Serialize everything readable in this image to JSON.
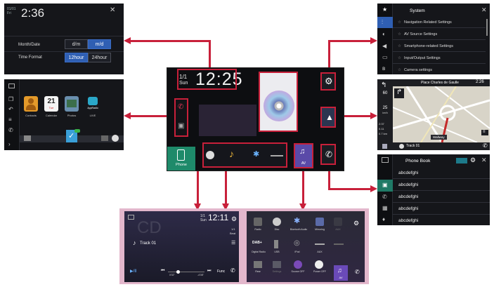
{
  "colors": {
    "accent": "#2f5fb3",
    "arrow": "#c8203a",
    "pink_bg": "#e3b7cc",
    "dark": "#1b1c20"
  },
  "clock_panel": {
    "time": "2:36",
    "date_mini_1": "01/01",
    "date_mini_2": "Fri",
    "rows": [
      {
        "label": "Month/Date",
        "options": [
          "d/m",
          "m/d"
        ],
        "selected": 1
      },
      {
        "label": "Time Format",
        "options": [
          "12hour",
          "24hour"
        ],
        "selected": 0
      }
    ]
  },
  "apps_panel": {
    "apps": [
      {
        "label": "Contacts",
        "icon": "contacts-icon"
      },
      {
        "label": "Calendar",
        "icon": "calendar-icon",
        "num": "21",
        "sub": "Tue"
      },
      {
        "label": "Photos",
        "icon": "photos-icon"
      },
      {
        "label": "LIVE",
        "icon": "appradio-icon",
        "tag": "AppRadio"
      }
    ]
  },
  "main_unit": {
    "date_1": "1/1",
    "date_2": "Sun",
    "time": "12:25",
    "phone_label": "Phone"
  },
  "system_panel": {
    "title": "System",
    "items": [
      "Navigation Related Settings",
      "AV Source Settings",
      "Smartphone-related Settings",
      "Input/Output Settings",
      "Camera settings"
    ]
  },
  "nav_panel": {
    "street": "Place Charles de Gaulle",
    "time": "2:26",
    "dist_top": "60",
    "speed": "25",
    "speed_unit": "km/h",
    "stats": [
      "2:37",
      "0.11",
      "0.7 km"
    ],
    "flag_label": "Wallway",
    "track": "Track 01"
  },
  "phonebook_panel": {
    "title": "Phone Book",
    "entries": [
      "abcdefghi",
      "abcdefghi",
      "abcdefghi",
      "abcdefghi",
      "abcdefghi"
    ]
  },
  "cd_panel": {
    "bg_label": "CD",
    "date_1": "1/1",
    "date_2": "Sun",
    "time": "12:11",
    "disc_label": "1/1",
    "disc_sub": "Beat",
    "track": "Track 01",
    "elapsed": "0'02\"",
    "remaining": "-4'08\"",
    "func_label": "Func"
  },
  "source_panel": {
    "sources": [
      [
        "Radio",
        "Disc",
        "Bluetooth Audio",
        "Mirroring",
        "AUX"
      ],
      [
        "Digital Radio",
        "USB",
        "iPod",
        "AUX",
        ""
      ],
      [
        "Rear",
        "Settings",
        "Source OFF",
        "Power OFF",
        ""
      ]
    ],
    "current": "AV"
  },
  "av_tile_label": "AV"
}
